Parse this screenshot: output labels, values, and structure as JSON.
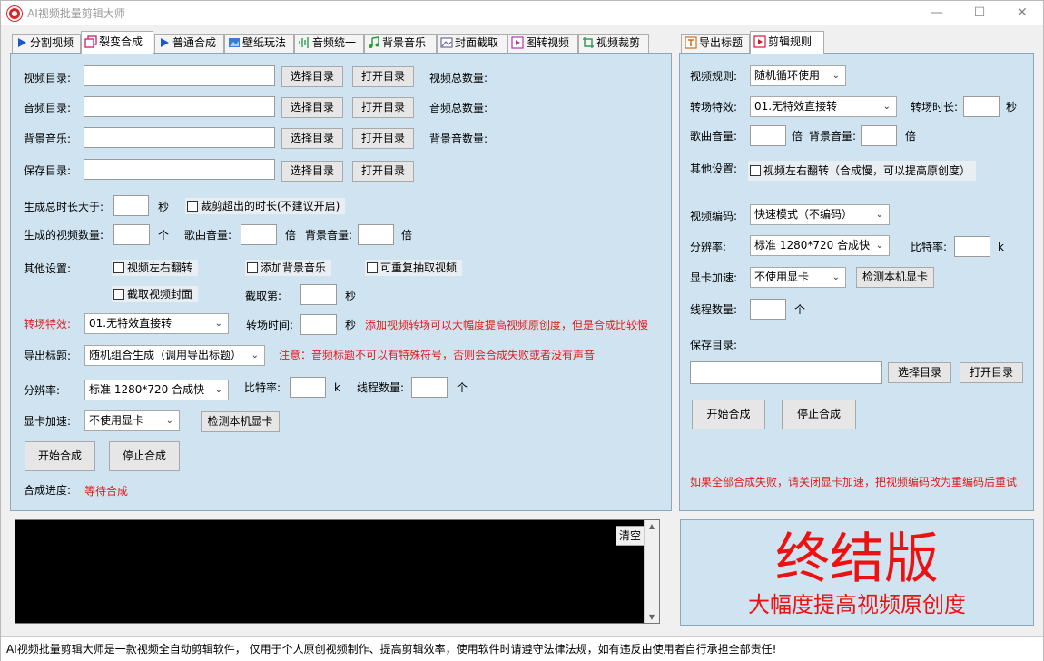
{
  "window": {
    "title": "AI视频批量剪辑大师"
  },
  "left_tabs": [
    {
      "label": "分割视频",
      "icon": "play-icon"
    },
    {
      "label": "裂变合成",
      "icon": "copy-icon"
    },
    {
      "label": "普通合成",
      "icon": "play-icon"
    },
    {
      "label": "壁纸玩法",
      "icon": "wallpaper-icon"
    },
    {
      "label": "音频统一",
      "icon": "audio-wave-icon"
    },
    {
      "label": "背景音乐",
      "icon": "music-note-icon"
    },
    {
      "label": "封面截取",
      "icon": "image-icon"
    },
    {
      "label": "图转视频",
      "icon": "picture-video-icon"
    },
    {
      "label": "视频裁剪",
      "icon": "crop-icon"
    }
  ],
  "right_tabs": [
    {
      "label": "导出标题",
      "icon": "title-icon"
    },
    {
      "label": "剪辑规则",
      "icon": "rules-icon"
    }
  ],
  "left": {
    "dirs": [
      {
        "label": "视频目录:",
        "value": "",
        "count_label": "视频总数量:"
      },
      {
        "label": "音频目录:",
        "value": "",
        "count_label": "音频总数量:"
      },
      {
        "label": "背景音乐:",
        "value": "",
        "count_label": "背景音数量:"
      },
      {
        "label": "保存目录:",
        "value": "",
        "count_label": ""
      }
    ],
    "select_dir": "选择目录",
    "open_dir": "打开目录",
    "total_duration_label": "生成总时长大于:",
    "sec": "秒",
    "trim_excess": "裁剪超出的时长(不建议开启)",
    "video_count_label": "生成的视频数量:",
    "unit_ge": "个",
    "song_volume_label": "歌曲音量:",
    "bei": "倍",
    "bg_volume_label": "背景音量:",
    "other_settings_label": "其他设置:",
    "flip_label": "视频左右翻转",
    "add_bgm_label": "添加背景音乐",
    "repeat_label": "可重复抽取视频",
    "capture_cover_label": "截取视频封面",
    "capture_at_label": "截取第:",
    "transition_label": "转场特效:",
    "transition_value": "01.无特效直接转",
    "transition_time_label": "转场时间:",
    "transition_tip": "添加视频转场可以大幅度提高视频原创度，但是合成比较慢",
    "export_title_label": "导出标题:",
    "export_title_value": "随机组合生成（调用导出标题）",
    "export_title_tip": "注意：音频标题不可以有特殊符号，否则会合成失败或者没有声音",
    "resolution_label": "分辨率:",
    "resolution_value": "标准 1280*720 合成快",
    "bitrate_label": "比特率:",
    "k": "k",
    "threads_label": "线程数量:",
    "gpu_label": "显卡加速:",
    "gpu_value": "不使用显卡",
    "detect_gpu": "检测本机显卡",
    "start": "开始合成",
    "stop": "停止合成",
    "progress_label": "合成进度:",
    "progress_value": "等待合成"
  },
  "right": {
    "video_rule_label": "视频规则:",
    "video_rule_value": "随机循环使用",
    "transition_label": "转场特效:",
    "transition_value": "01.无特效直接转",
    "transition_dur_label": "转场时长:",
    "sec": "秒",
    "song_volume_label": "歌曲音量:",
    "bei": "倍",
    "bg_volume_label": "背景音量:",
    "other_settings_label": "其他设置:",
    "flip_label": "视频左右翻转（合成慢，可以提高原创度）",
    "encode_label": "视频编码:",
    "encode_value": "快速模式（不编码）",
    "resolution_label": "分辨率:",
    "resolution_value": "标准 1280*720 合成快",
    "bitrate_label": "比特率:",
    "k": "k",
    "gpu_label": "显卡加速:",
    "gpu_value": "不使用显卡",
    "detect_gpu": "检测本机显卡",
    "threads_label": "线程数量:",
    "unit_ge": "个",
    "save_dir_label": "保存目录:",
    "select_dir": "选择目录",
    "open_dir": "打开目录",
    "start": "开始合成",
    "stop": "停止合成",
    "fail_tip": "如果全部合成失败，请关闭显卡加速，把视频编码改为重编码后重试"
  },
  "log": {
    "clear": "清空"
  },
  "banner": {
    "title": "终结版",
    "subtitle": "大幅度提高视频原创度"
  },
  "statusbar": {
    "text": "AI视频批量剪辑大师是一款视频全自动剪辑软件，  仅用于个人原创视频制作、提高剪辑效率，使用软件时请遵守法律法规，如有违反由使用者自行承担全部责任!"
  },
  "colors": {
    "panel": "#cfe4f0",
    "tip_red": "#e41b1b",
    "banner_red": "#ee1111"
  }
}
